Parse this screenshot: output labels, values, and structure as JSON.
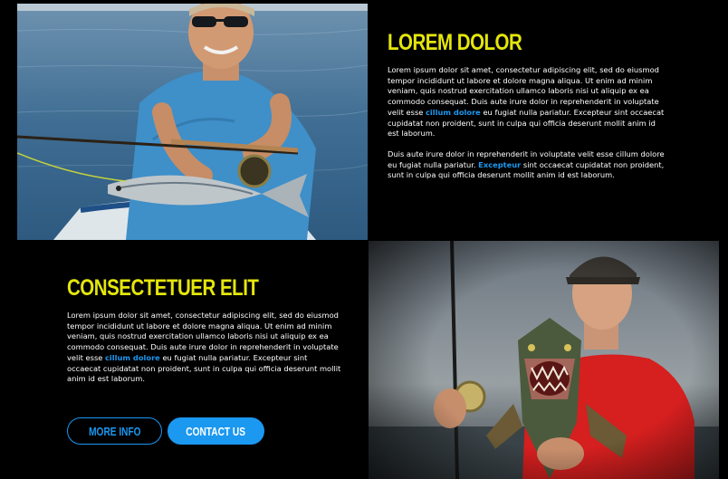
{
  "section1": {
    "heading": "LOREM DOLOR",
    "p1_a": "Lorem ipsum dolor sit amet, consectetur adipiscing elit, sed do eiusmod tempor incididunt ut labore et dolore magna aliqua. Ut enim ad minim veniam, quis nostrud exercitation ullamco laboris nisi ut aliquip ex ea commodo consequat. Duis aute irure dolor in reprehenderit in voluptate velit esse ",
    "p1_link": "cillum dolore",
    "p1_b": " eu fugiat nulla pariatur. Excepteur sint occaecat cupidatat non proident, sunt in culpa qui officia deserunt mollit anim id est laborum.",
    "p2_a": "Duis aute irure dolor in reprehenderit in voluptate velit esse cillum dolore eu fugiat nulla pariatur. ",
    "p2_link": "Excepteur",
    "p2_b": " sint occaecat cupidatat non proident, sunt in culpa qui officia deserunt mollit anim id est laborum."
  },
  "section2": {
    "heading": "CONSECTETUER ELIT",
    "p1_a": "Lorem ipsum dolor sit amet, consectetur adipiscing elit, sed do eiusmod tempor incididunt ut labore et dolore magna aliqua. Ut enim ad minim veniam, quis nostrud exercitation ullamco laboris nisi ut aliquip ex ea commodo consequat. Duis aute irure dolor in reprehenderit in voluptate velit esse ",
    "p1_link": "cillum dolore",
    "p1_b": " eu fugiat nulla pariatur. Excepteur sint occaecat cupidatat non proident, sunt in culpa qui officia deserunt mollit anim id est laborum."
  },
  "buttons": {
    "more_info": "MORE INFO",
    "contact_us": "CONTACT US"
  },
  "colors": {
    "accent_yellow": "#e4e60b",
    "accent_blue": "#1b98f0",
    "background": "#000000",
    "text": "#ffffff"
  },
  "icons": {
    "photo1": "fisherman-boat-photo",
    "photo2": "fisherman-pike-photo"
  }
}
